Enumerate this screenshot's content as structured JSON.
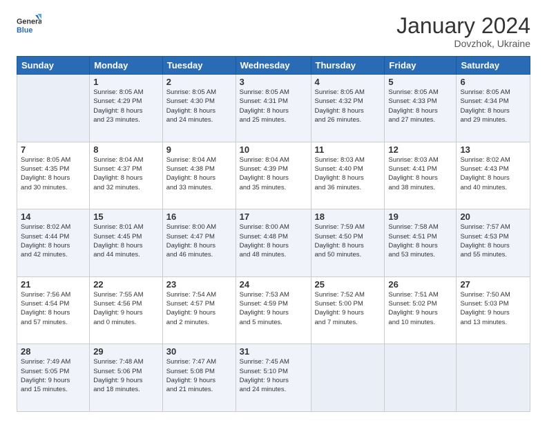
{
  "logo": {
    "line1": "General",
    "line2": "Blue"
  },
  "header": {
    "month": "January 2024",
    "location": "Dovzhok, Ukraine"
  },
  "weekdays": [
    "Sunday",
    "Monday",
    "Tuesday",
    "Wednesday",
    "Thursday",
    "Friday",
    "Saturday"
  ],
  "weeks": [
    [
      {
        "day": "",
        "info": ""
      },
      {
        "day": "1",
        "info": "Sunrise: 8:05 AM\nSunset: 4:29 PM\nDaylight: 8 hours\nand 23 minutes."
      },
      {
        "day": "2",
        "info": "Sunrise: 8:05 AM\nSunset: 4:30 PM\nDaylight: 8 hours\nand 24 minutes."
      },
      {
        "day": "3",
        "info": "Sunrise: 8:05 AM\nSunset: 4:31 PM\nDaylight: 8 hours\nand 25 minutes."
      },
      {
        "day": "4",
        "info": "Sunrise: 8:05 AM\nSunset: 4:32 PM\nDaylight: 8 hours\nand 26 minutes."
      },
      {
        "day": "5",
        "info": "Sunrise: 8:05 AM\nSunset: 4:33 PM\nDaylight: 8 hours\nand 27 minutes."
      },
      {
        "day": "6",
        "info": "Sunrise: 8:05 AM\nSunset: 4:34 PM\nDaylight: 8 hours\nand 29 minutes."
      }
    ],
    [
      {
        "day": "7",
        "info": "Sunrise: 8:05 AM\nSunset: 4:35 PM\nDaylight: 8 hours\nand 30 minutes."
      },
      {
        "day": "8",
        "info": "Sunrise: 8:04 AM\nSunset: 4:37 PM\nDaylight: 8 hours\nand 32 minutes."
      },
      {
        "day": "9",
        "info": "Sunrise: 8:04 AM\nSunset: 4:38 PM\nDaylight: 8 hours\nand 33 minutes."
      },
      {
        "day": "10",
        "info": "Sunrise: 8:04 AM\nSunset: 4:39 PM\nDaylight: 8 hours\nand 35 minutes."
      },
      {
        "day": "11",
        "info": "Sunrise: 8:03 AM\nSunset: 4:40 PM\nDaylight: 8 hours\nand 36 minutes."
      },
      {
        "day": "12",
        "info": "Sunrise: 8:03 AM\nSunset: 4:41 PM\nDaylight: 8 hours\nand 38 minutes."
      },
      {
        "day": "13",
        "info": "Sunrise: 8:02 AM\nSunset: 4:43 PM\nDaylight: 8 hours\nand 40 minutes."
      }
    ],
    [
      {
        "day": "14",
        "info": "Sunrise: 8:02 AM\nSunset: 4:44 PM\nDaylight: 8 hours\nand 42 minutes."
      },
      {
        "day": "15",
        "info": "Sunrise: 8:01 AM\nSunset: 4:45 PM\nDaylight: 8 hours\nand 44 minutes."
      },
      {
        "day": "16",
        "info": "Sunrise: 8:00 AM\nSunset: 4:47 PM\nDaylight: 8 hours\nand 46 minutes."
      },
      {
        "day": "17",
        "info": "Sunrise: 8:00 AM\nSunset: 4:48 PM\nDaylight: 8 hours\nand 48 minutes."
      },
      {
        "day": "18",
        "info": "Sunrise: 7:59 AM\nSunset: 4:50 PM\nDaylight: 8 hours\nand 50 minutes."
      },
      {
        "day": "19",
        "info": "Sunrise: 7:58 AM\nSunset: 4:51 PM\nDaylight: 8 hours\nand 53 minutes."
      },
      {
        "day": "20",
        "info": "Sunrise: 7:57 AM\nSunset: 4:53 PM\nDaylight: 8 hours\nand 55 minutes."
      }
    ],
    [
      {
        "day": "21",
        "info": "Sunrise: 7:56 AM\nSunset: 4:54 PM\nDaylight: 8 hours\nand 57 minutes."
      },
      {
        "day": "22",
        "info": "Sunrise: 7:55 AM\nSunset: 4:56 PM\nDaylight: 9 hours\nand 0 minutes."
      },
      {
        "day": "23",
        "info": "Sunrise: 7:54 AM\nSunset: 4:57 PM\nDaylight: 9 hours\nand 2 minutes."
      },
      {
        "day": "24",
        "info": "Sunrise: 7:53 AM\nSunset: 4:59 PM\nDaylight: 9 hours\nand 5 minutes."
      },
      {
        "day": "25",
        "info": "Sunrise: 7:52 AM\nSunset: 5:00 PM\nDaylight: 9 hours\nand 7 minutes."
      },
      {
        "day": "26",
        "info": "Sunrise: 7:51 AM\nSunset: 5:02 PM\nDaylight: 9 hours\nand 10 minutes."
      },
      {
        "day": "27",
        "info": "Sunrise: 7:50 AM\nSunset: 5:03 PM\nDaylight: 9 hours\nand 13 minutes."
      }
    ],
    [
      {
        "day": "28",
        "info": "Sunrise: 7:49 AM\nSunset: 5:05 PM\nDaylight: 9 hours\nand 15 minutes."
      },
      {
        "day": "29",
        "info": "Sunrise: 7:48 AM\nSunset: 5:06 PM\nDaylight: 9 hours\nand 18 minutes."
      },
      {
        "day": "30",
        "info": "Sunrise: 7:47 AM\nSunset: 5:08 PM\nDaylight: 9 hours\nand 21 minutes."
      },
      {
        "day": "31",
        "info": "Sunrise: 7:45 AM\nSunset: 5:10 PM\nDaylight: 9 hours\nand 24 minutes."
      },
      {
        "day": "",
        "info": ""
      },
      {
        "day": "",
        "info": ""
      },
      {
        "day": "",
        "info": ""
      }
    ]
  ]
}
